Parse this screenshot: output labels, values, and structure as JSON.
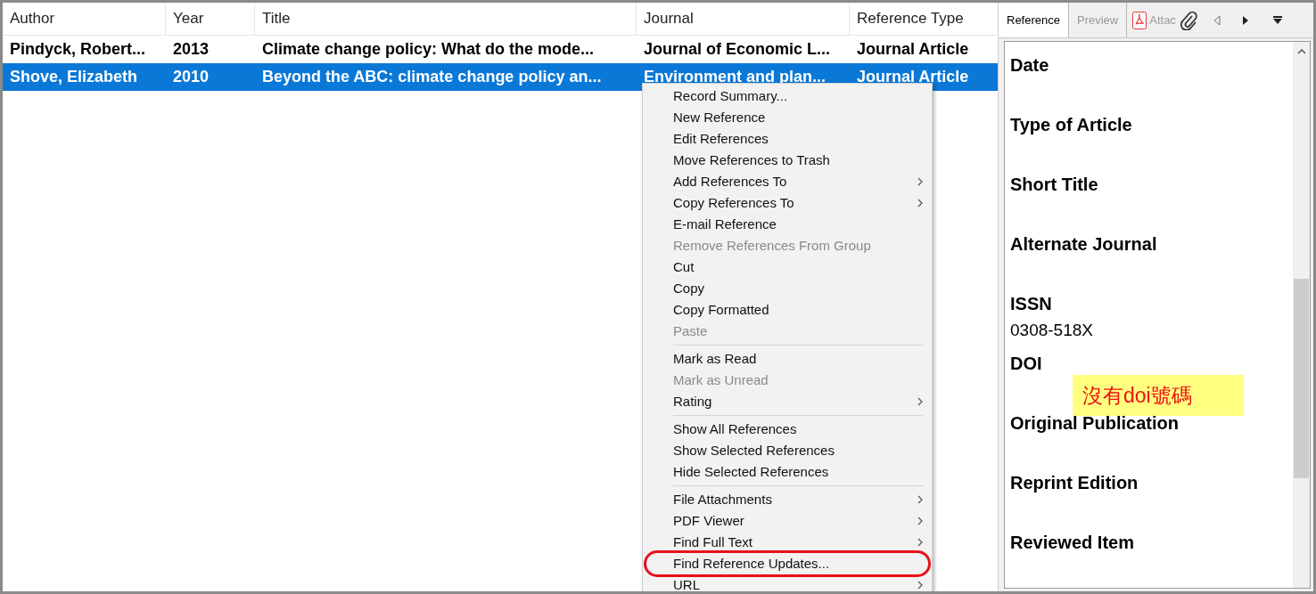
{
  "table": {
    "columns": [
      "Author",
      "Year",
      "Title",
      "Journal",
      "Reference Type"
    ],
    "rows": [
      {
        "selected": false,
        "cells": [
          "Pindyck, Robert...",
          "2013",
          "Climate change policy: What do the mode...",
          "Journal of Economic L...",
          "Journal Article"
        ]
      },
      {
        "selected": true,
        "cells": [
          "Shove, Elizabeth",
          "2010",
          "Beyond the ABC: climate change policy an...",
          "Environment and plan...",
          "Journal Article"
        ]
      }
    ]
  },
  "context_menu": {
    "groups": [
      [
        {
          "label": "Record Summary...",
          "disabled": false,
          "submenu": false,
          "highlighted": false
        },
        {
          "label": "New Reference",
          "disabled": false,
          "submenu": false,
          "highlighted": false
        },
        {
          "label": "Edit References",
          "disabled": false,
          "submenu": false,
          "highlighted": false
        },
        {
          "label": "Move References to Trash",
          "disabled": false,
          "submenu": false,
          "highlighted": false
        },
        {
          "label": "Add References To",
          "disabled": false,
          "submenu": true,
          "highlighted": false
        },
        {
          "label": "Copy References To",
          "disabled": false,
          "submenu": true,
          "highlighted": false
        },
        {
          "label": "E-mail Reference",
          "disabled": false,
          "submenu": false,
          "highlighted": false
        },
        {
          "label": "Remove References From Group",
          "disabled": true,
          "submenu": false,
          "highlighted": false
        },
        {
          "label": "Cut",
          "disabled": false,
          "submenu": false,
          "highlighted": false
        },
        {
          "label": "Copy",
          "disabled": false,
          "submenu": false,
          "highlighted": false
        },
        {
          "label": "Copy Formatted",
          "disabled": false,
          "submenu": false,
          "highlighted": false
        },
        {
          "label": "Paste",
          "disabled": true,
          "submenu": false,
          "highlighted": false
        }
      ],
      [
        {
          "label": "Mark as Read",
          "disabled": false,
          "submenu": false,
          "highlighted": false
        },
        {
          "label": "Mark as Unread",
          "disabled": true,
          "submenu": false,
          "highlighted": false
        },
        {
          "label": "Rating",
          "disabled": false,
          "submenu": true,
          "highlighted": false
        }
      ],
      [
        {
          "label": "Show All References",
          "disabled": false,
          "submenu": false,
          "highlighted": false
        },
        {
          "label": "Show Selected References",
          "disabled": false,
          "submenu": false,
          "highlighted": false
        },
        {
          "label": "Hide Selected References",
          "disabled": false,
          "submenu": false,
          "highlighted": false
        }
      ],
      [
        {
          "label": "File Attachments",
          "disabled": false,
          "submenu": true,
          "highlighted": false
        },
        {
          "label": "PDF Viewer",
          "disabled": false,
          "submenu": true,
          "highlighted": false
        },
        {
          "label": "Find Full Text",
          "disabled": false,
          "submenu": true,
          "highlighted": false
        },
        {
          "label": "Find Reference Updates...",
          "disabled": false,
          "submenu": false,
          "highlighted": true
        },
        {
          "label": "URL",
          "disabled": false,
          "submenu": true,
          "highlighted": false
        }
      ]
    ]
  },
  "panel": {
    "tabs": [
      {
        "label": "Reference",
        "selected": true
      },
      {
        "label": "Preview",
        "selected": false
      }
    ],
    "attachments_label": "Attac",
    "fields": [
      {
        "label": "Date"
      },
      {
        "label": "Type of Article"
      },
      {
        "label": "Short Title"
      },
      {
        "label": "Alternate Journal"
      },
      {
        "label": "ISSN",
        "value": "0308-518X"
      },
      {
        "label": "DOI"
      },
      {
        "label": "Original Publication"
      },
      {
        "label": "Reprint Edition"
      },
      {
        "label": "Reviewed Item"
      }
    ],
    "note": "沒有doi號碼"
  }
}
